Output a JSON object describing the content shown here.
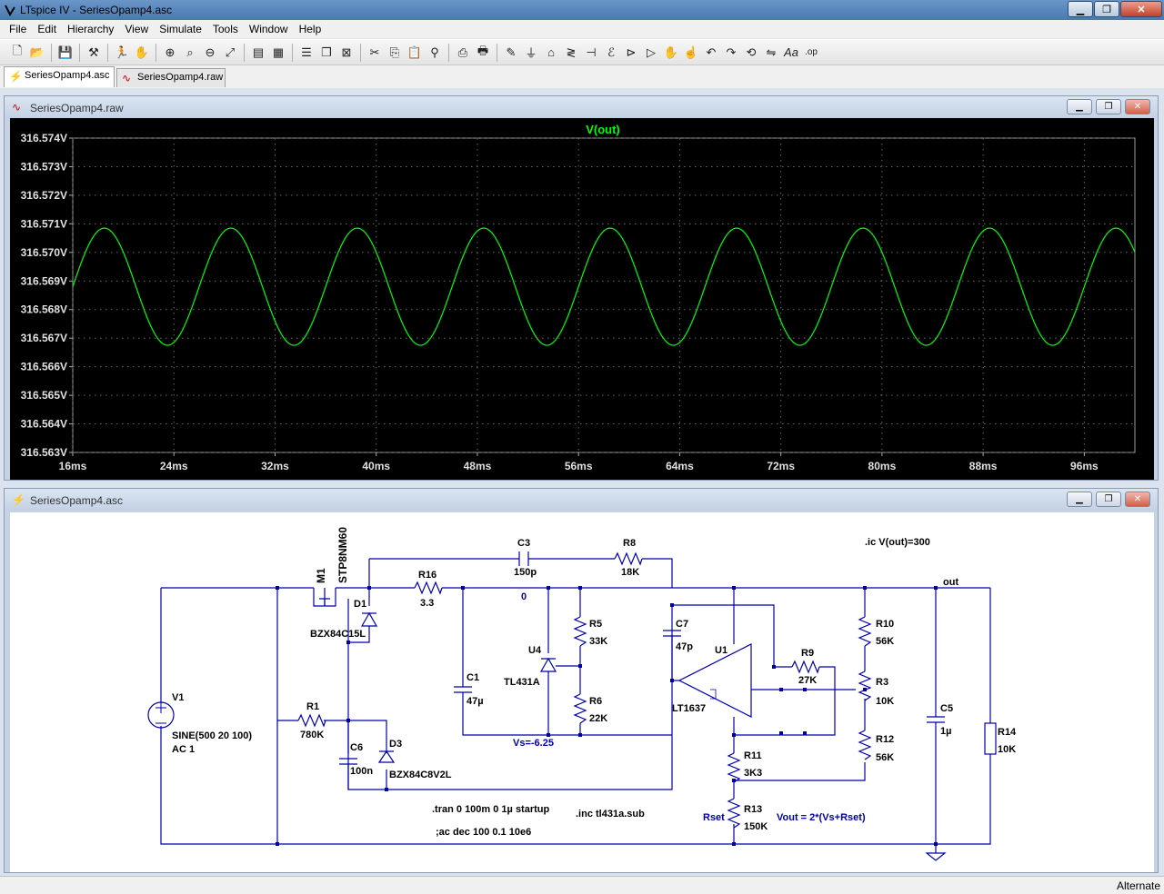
{
  "window": {
    "title": "LTspice IV - SeriesOpamp4.asc"
  },
  "menu": [
    "File",
    "Edit",
    "Hierarchy",
    "View",
    "Simulate",
    "Tools",
    "Window",
    "Help"
  ],
  "toolbar": {
    "icons": [
      "new-schematic-icon",
      "open-icon",
      "save-icon",
      "control-panel-icon",
      "run-icon",
      "halt-icon",
      "zoom-in-icon",
      "zoom-rect-icon",
      "zoom-out-icon",
      "zoom-fit-icon",
      "autorange-icon",
      "delete-traces-icon",
      "tile-horizontal-icon",
      "cascade-icon",
      "close-window-icon",
      "cut-icon",
      "copy-icon",
      "paste-icon",
      "find-icon",
      "print-setup-icon",
      "print-icon",
      "wire-icon",
      "ground-icon",
      "label-net-icon",
      "resistor-icon",
      "capacitor-icon",
      "inductor-icon",
      "diode-icon",
      "component-icon",
      "move-icon",
      "drag-icon",
      "undo-icon",
      "redo-icon",
      "rotate-icon",
      "mirror-icon",
      "text-icon",
      "spice-directive-icon"
    ]
  },
  "tabs": [
    {
      "label": "SeriesOpamp4.asc",
      "active": true
    },
    {
      "label": "SeriesOpamp4.raw",
      "active": false
    }
  ],
  "waveform": {
    "window_title": "SeriesOpamp4.raw",
    "trace_label": "V(out)",
    "trace_color": "#00ff00",
    "background": "#000000"
  },
  "chart_data": {
    "type": "line",
    "title": "V(out)",
    "xlabel": "",
    "ylabel": "",
    "xlim": [
      16,
      100
    ],
    "ylim": [
      316.563,
      316.574
    ],
    "xticks": [
      "16ms",
      "24ms",
      "32ms",
      "40ms",
      "48ms",
      "56ms",
      "64ms",
      "72ms",
      "80ms",
      "88ms",
      "96ms"
    ],
    "yticks": [
      "316.574V",
      "316.573V",
      "316.572V",
      "316.571V",
      "316.570V",
      "316.569V",
      "316.568V",
      "316.567V",
      "316.566V",
      "316.565V",
      "316.564V",
      "316.563V"
    ],
    "series": [
      {
        "name": "V(out)",
        "waveform": "sine",
        "frequency_hz": 100,
        "offset": 316.5688,
        "amplitude": 0.00205,
        "peak_time_ms": 18.5,
        "color": "#00ff00"
      }
    ]
  },
  "schematic": {
    "window_title": "SeriesOpamp4.asc",
    "labels": {
      "ic": ".ic V(out)=300",
      "out": "out",
      "m1": "M1",
      "stp": "STP8NM60",
      "d1": "D1",
      "bzx1": "BZX84C15L",
      "r16": "R16",
      "r16v": "3.3",
      "c3": "C3",
      "c3v": "150p",
      "r8": "R8",
      "r8v": "18K",
      "zero": "0",
      "r5": "R5",
      "r5v": "33K",
      "u4": "U4",
      "tl431": "TL431A",
      "r6": "R6",
      "r6v": "22K",
      "c1": "C1",
      "c1v": "47µ",
      "vs": "Vs=-6.25",
      "c7": "C7",
      "c7v": "47p",
      "u1": "U1",
      "lt1637": "LT1637",
      "r9": "R9",
      "r9v": "27K",
      "r10": "R10",
      "r10v": "56K",
      "r3": "R3",
      "r3v": "10K",
      "r12": "R12",
      "r12v": "56K",
      "c5": "C5",
      "c5v": "1µ",
      "r14": "R14",
      "r14v": "10K",
      "v1": "V1",
      "sine": "SINE(500 20 100)",
      "ac": "AC 1",
      "r1": "R1",
      "r1v": "780K",
      "c6": "C6",
      "c6v": "100n",
      "d3": "D3",
      "bzx2": "BZX84C8V2L",
      "r11": "R11",
      "r11v": "3K3",
      "r13": "R13",
      "r13v": "150K",
      "rset": "Rset",
      "vout": "Vout = 2*(Vs+Rset)",
      "tran": ".tran 0 100m 0 1µ startup",
      "inc": ".inc tl431a.sub",
      "acdir": ";ac dec 100 0.1 10e6"
    }
  },
  "status": {
    "text": "Alternate"
  }
}
